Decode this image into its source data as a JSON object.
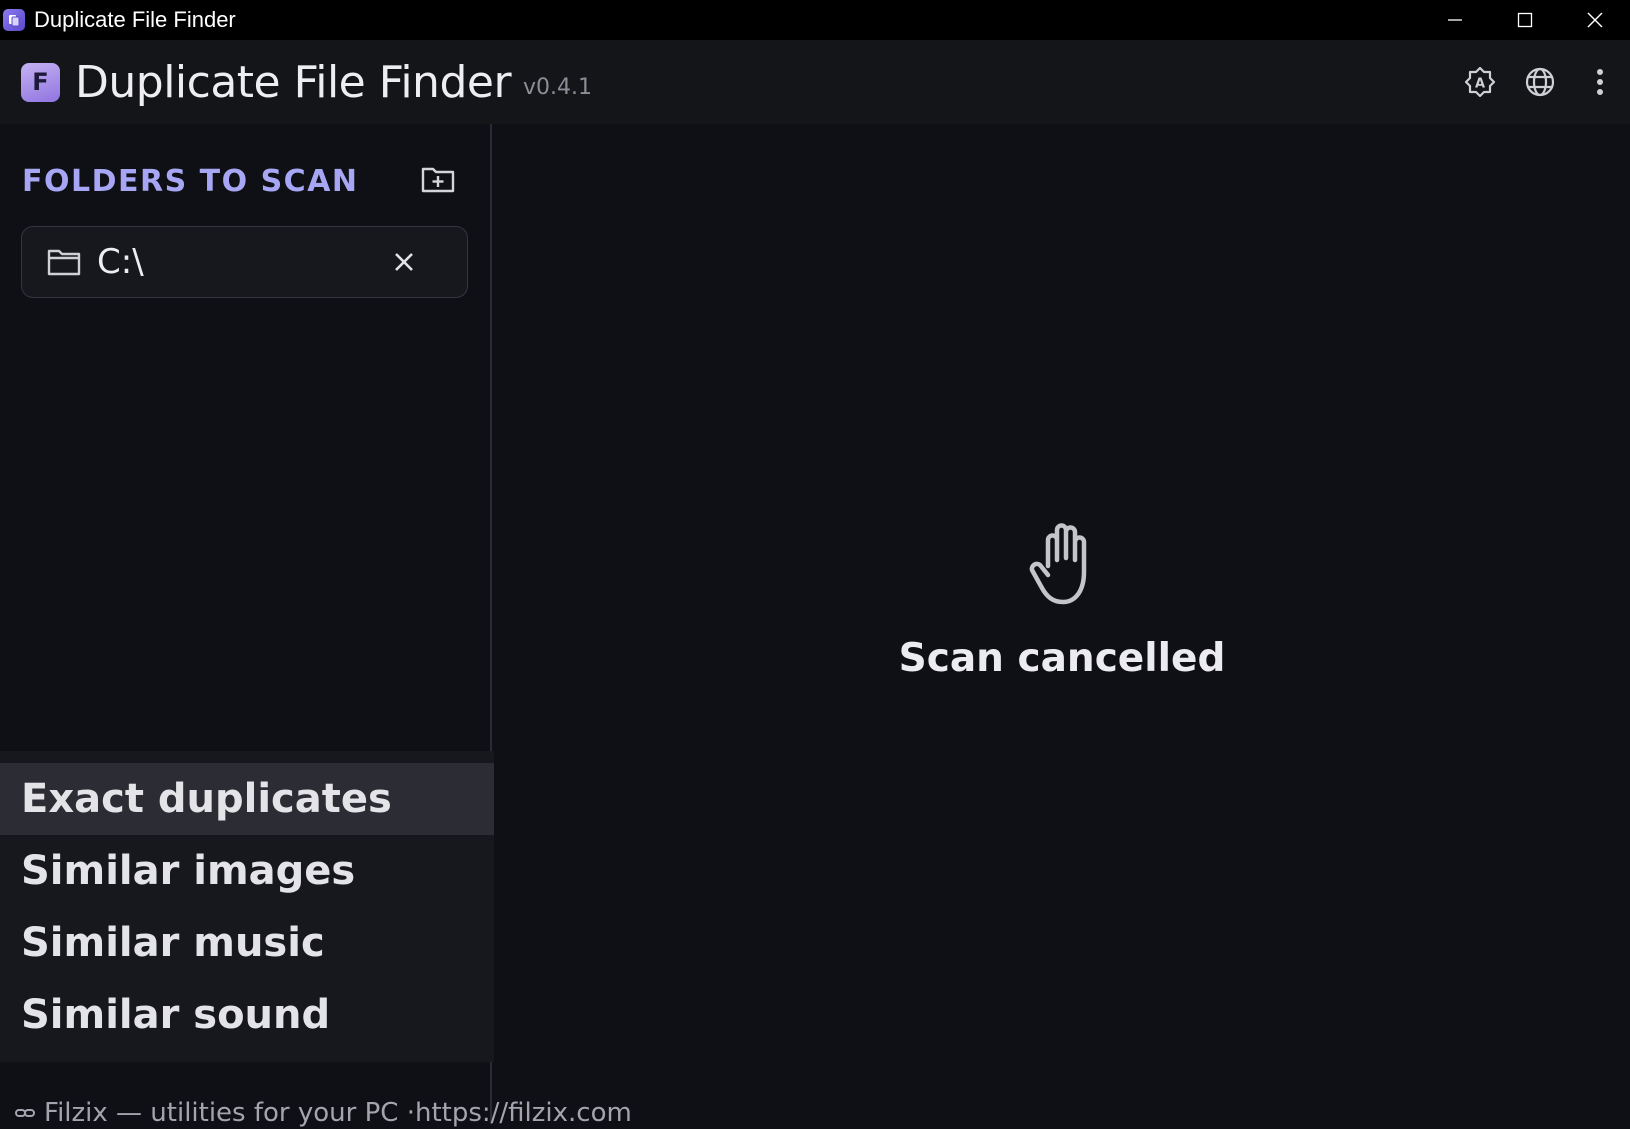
{
  "window": {
    "title": "Duplicate File Finder",
    "icon": "app-icon",
    "controls": [
      "minimize-icon",
      "maximize-icon",
      "close-icon"
    ]
  },
  "header": {
    "logo_letter": "F",
    "title": "Duplicate File Finder",
    "version": "v0.4.1",
    "actions": [
      "theme-icon",
      "language-icon",
      "more-vert-icon"
    ]
  },
  "sidebar": {
    "section_title": "FOLDERS TO SCAN",
    "add_folder_icon": "folder-add-icon",
    "folders": [
      {
        "path": "C:\\",
        "icon": "folder-icon",
        "remove_icon": "close-icon"
      }
    ],
    "modes": [
      {
        "label": "Exact duplicates",
        "active": true
      },
      {
        "label": "Similar images",
        "active": false
      },
      {
        "label": "Similar music",
        "active": false
      },
      {
        "label": "Similar sound",
        "active": false
      }
    ]
  },
  "main": {
    "status_icon": "hand-stop-icon",
    "status_text": "Scan cancelled"
  },
  "footer": {
    "icon": "link-icon",
    "text": "Filzix — utilities for your PC · ",
    "link": "https://filzix.com"
  },
  "colors": {
    "accent": "#a7a6f5",
    "background": "#0f1015",
    "panel": "#17181d",
    "active_mode": "#2c2d34"
  }
}
